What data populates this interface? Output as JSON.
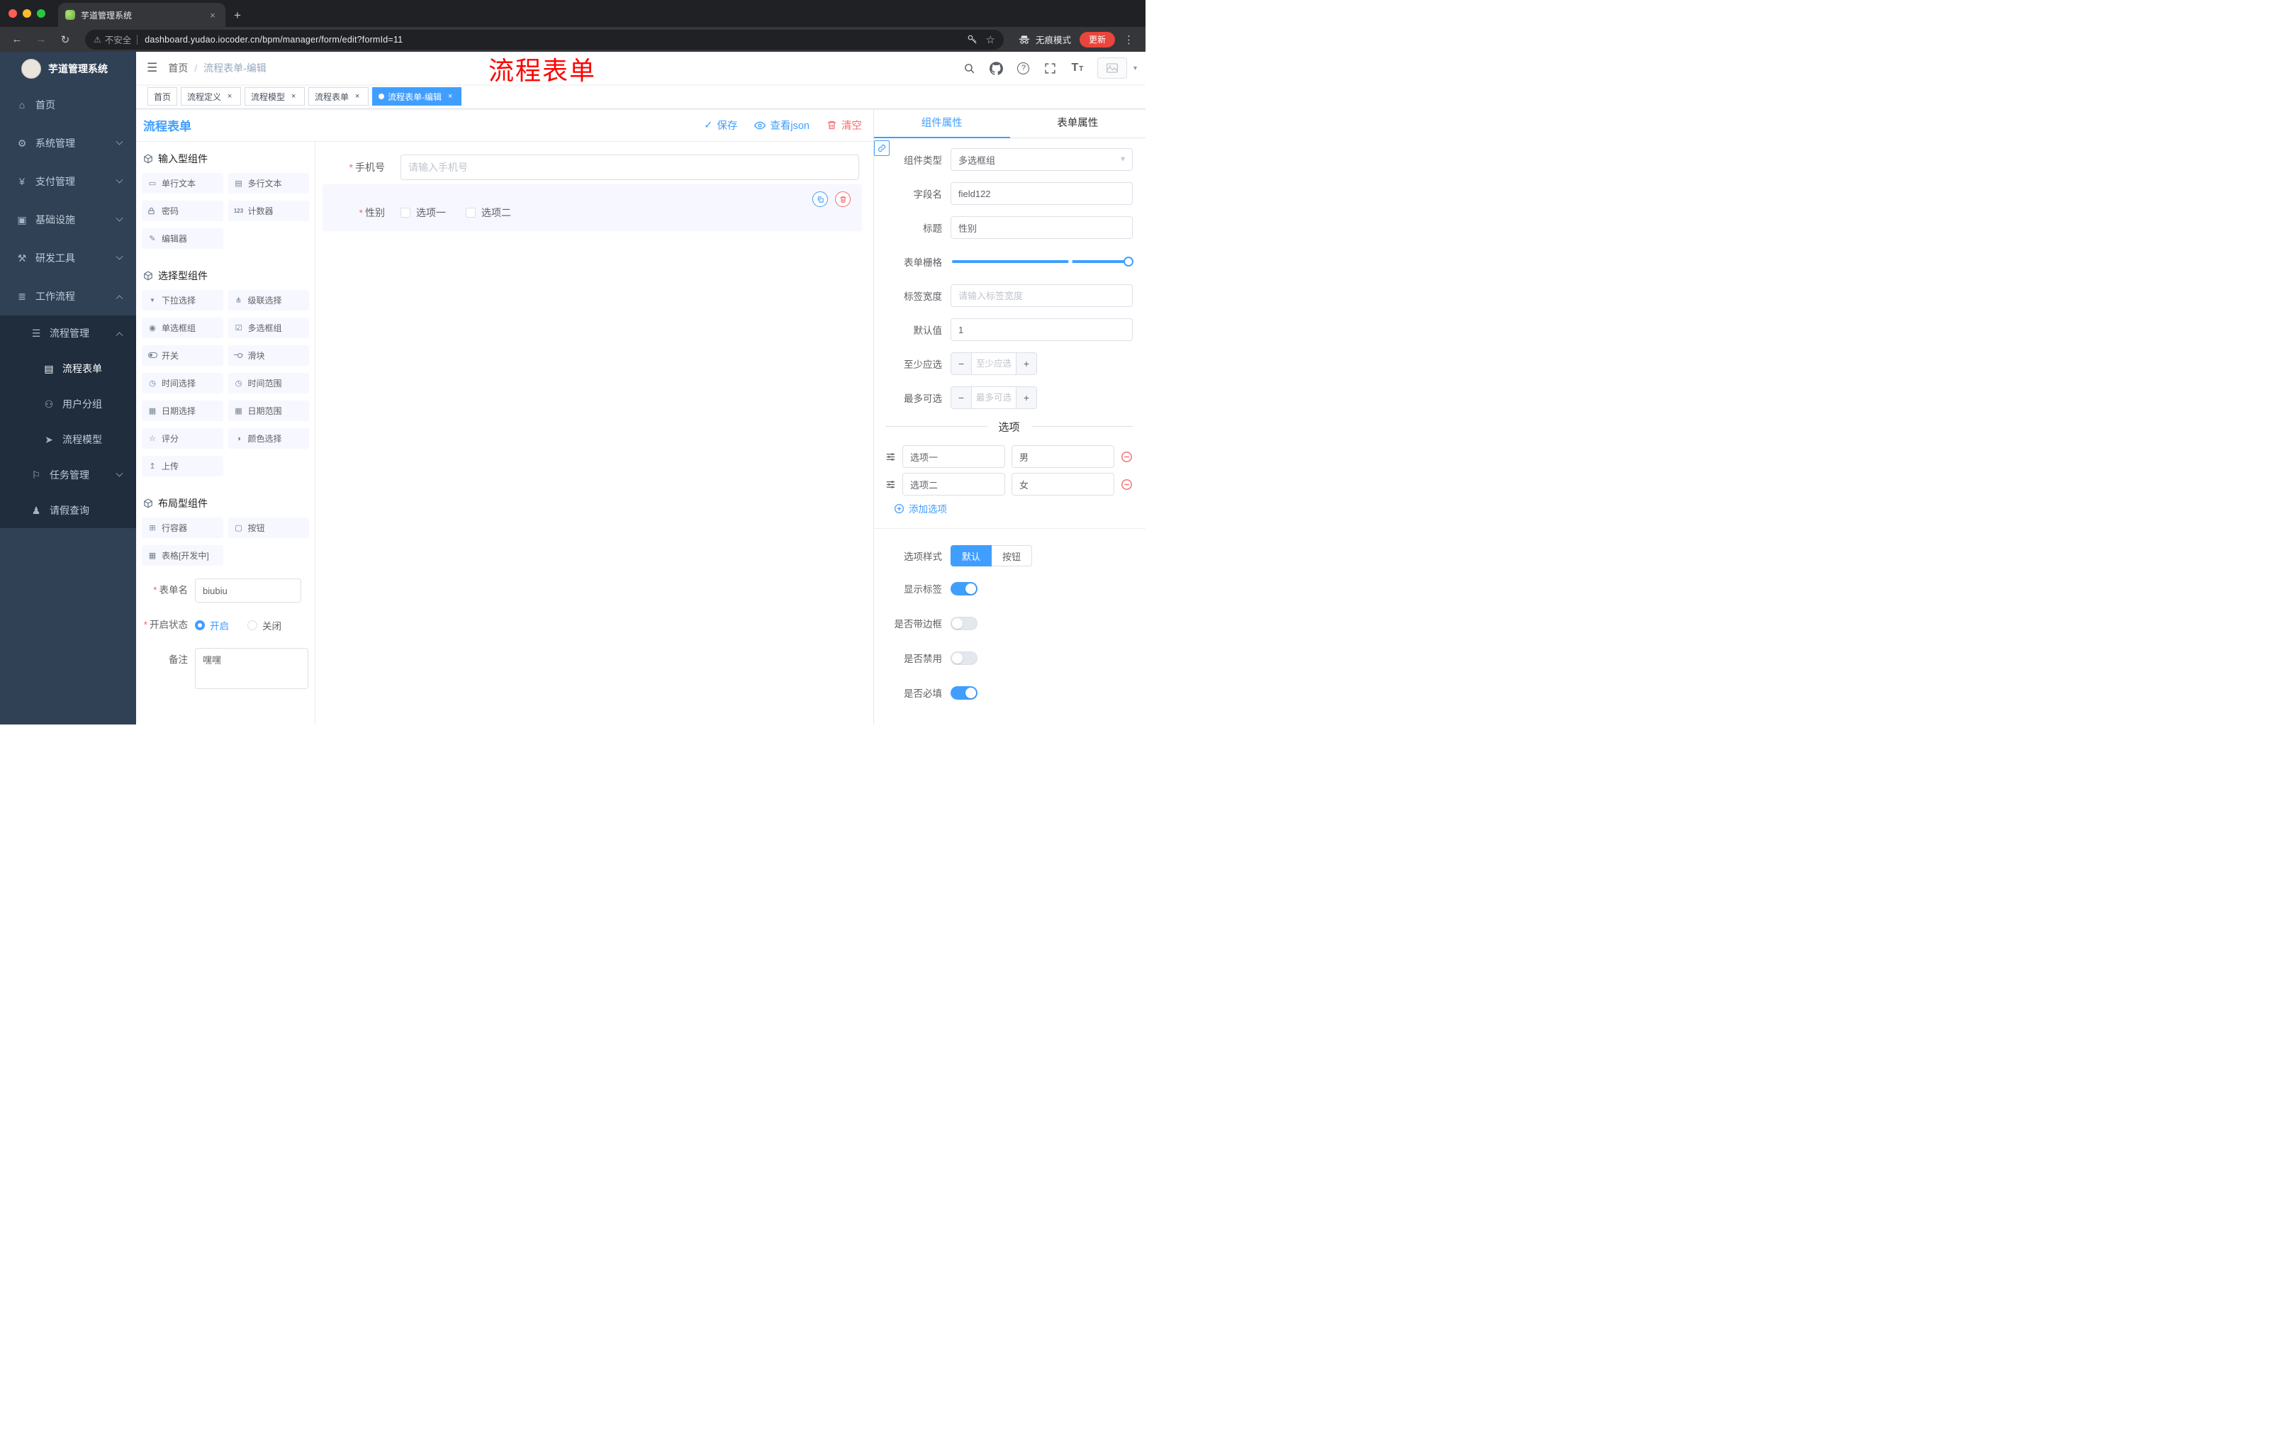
{
  "colors": {
    "primary": "#409eff",
    "danger": "#f56c6c",
    "sidebar_bg": "#304156",
    "submenu_bg": "#1f2d3d",
    "annotation_red": "#ff0000",
    "active_tag": "#409eff"
  },
  "icons": {
    "save": "check",
    "view_json": "eye",
    "clear": "trash",
    "copy": "copy-squares",
    "delete": "trash",
    "add_option": "plus-circle",
    "remove_option": "minus-circle",
    "drag": "sliders",
    "panel_handle": "chain-link",
    "header": [
      "magnifier",
      "github-logo",
      "question-circle",
      "fullscreen-corners",
      "font-size-TT"
    ]
  },
  "browser": {
    "tab_title": "芋道管理系统",
    "tab_close": "×",
    "new_tab": "+",
    "security_label": "不安全",
    "url": "dashboard.yudao.iocoder.cn/bpm/manager/form/edit?formId=11",
    "incognito_label": "无痕模式",
    "update_label": "更新"
  },
  "sidebar": {
    "logo_title": "芋道管理系统",
    "items": [
      {
        "label": "首页"
      },
      {
        "label": "系统管理"
      },
      {
        "label": "支付管理"
      },
      {
        "label": "基础设施"
      },
      {
        "label": "研发工具"
      },
      {
        "label": "工作流程"
      },
      {
        "label": "流程管理"
      },
      {
        "label": "流程表单"
      },
      {
        "label": "用户分组"
      },
      {
        "label": "流程模型"
      },
      {
        "label": "任务管理"
      },
      {
        "label": "请假查询"
      }
    ]
  },
  "header": {
    "breadcrumb": {
      "home": "首页",
      "separator": "/",
      "current": "流程表单-编辑"
    },
    "annotation": "流程表单"
  },
  "tags": {
    "close_label": "×",
    "items": [
      {
        "label": "首页"
      },
      {
        "label": "流程定义"
      },
      {
        "label": "流程模型"
      },
      {
        "label": "流程表单"
      },
      {
        "label": "流程表单-编辑"
      }
    ]
  },
  "designer": {
    "title": "流程表单",
    "actions": {
      "save": "保存",
      "view_json": "查看json",
      "clear": "清空"
    },
    "palette": {
      "sections": [
        {
          "title": "输入型组件",
          "items": [
            "单行文本",
            "多行文本",
            "密码",
            "计数器",
            "编辑器"
          ]
        },
        {
          "title": "选择型组件",
          "items": [
            "下拉选择",
            "级联选择",
            "单选框组",
            "多选框组",
            "开关",
            "滑块",
            "时间选择",
            "时间范围",
            "日期选择",
            "日期范围",
            "评分",
            "颜色选择",
            "上传"
          ]
        },
        {
          "title": "布局型组件",
          "items": [
            "行容器",
            "按钮",
            "表格[开发中]"
          ]
        }
      ]
    },
    "meta": {
      "form_name_label": "表单名",
      "form_name_value": "biubiu",
      "status_label": "开启状态",
      "status_on": "开启",
      "status_off": "关闭",
      "remark_label": "备注",
      "remark_value": "嘿嘿"
    },
    "canvas": {
      "phone_label": "手机号",
      "phone_placeholder": "请输入手机号",
      "gender_label": "性别",
      "gender_options": [
        "选项一",
        "选项二"
      ]
    }
  },
  "props": {
    "tabs": {
      "component": "组件属性",
      "form": "表单属性"
    },
    "fields": {
      "type_label": "组件类型",
      "type_value": "多选框组",
      "name_label": "字段名",
      "name_value": "field122",
      "title_label": "标题",
      "title_value": "性别",
      "grid_label": "表单栅格",
      "width_label": "标签宽度",
      "width_placeholder": "请输入标签宽度",
      "default_label": "默认值",
      "default_value": "1",
      "min_label": "至少应选",
      "min_placeholder": "至少应选",
      "max_label": "最多可选",
      "max_placeholder": "最多可选",
      "stepper_minus": "−",
      "stepper_plus": "+"
    },
    "options_title": "选项",
    "options": [
      {
        "label": "选项一",
        "value": "男"
      },
      {
        "label": "选项二",
        "value": "女"
      }
    ],
    "add_option": "添加选项",
    "style_label": "选项样式",
    "style_options": [
      "默认",
      "按钮"
    ],
    "style_selected": "默认",
    "switches": [
      {
        "label": "显示标签",
        "on": true
      },
      {
        "label": "是否带边框",
        "on": false
      },
      {
        "label": "是否禁用",
        "on": false
      },
      {
        "label": "是否必填",
        "on": true
      }
    ]
  }
}
